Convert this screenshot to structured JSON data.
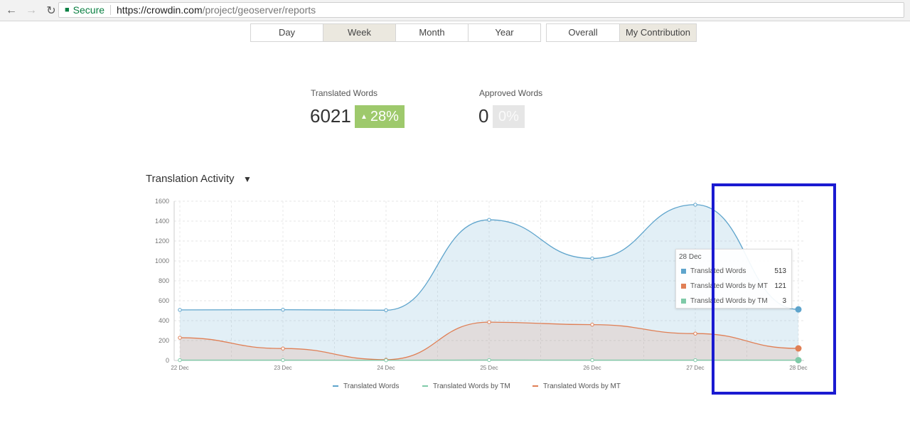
{
  "browser": {
    "secure_label": "Secure",
    "url_host": "https://crowdin.com",
    "url_path": "/project/geoserver/reports"
  },
  "period_tabs": [
    "Day",
    "Week",
    "Month",
    "Year"
  ],
  "period_active": "Week",
  "scope_tabs": [
    "Overall",
    "My Contribution"
  ],
  "scope_active": "My Contribution",
  "stats": {
    "translated_label": "Translated Words",
    "translated_value": "6021",
    "translated_change": "28%",
    "approved_label": "Approved Words",
    "approved_value": "0",
    "approved_change": "0%"
  },
  "section": {
    "title": "Translation Activity"
  },
  "colors": {
    "translated": "#5ea4cc",
    "mt": "#e07f55",
    "tm": "#7fcaa8",
    "badge_green": "#9ec96c",
    "highlight": "#1a1ad1"
  },
  "chart_data": {
    "type": "area",
    "categories": [
      "22 Dec",
      "23 Dec",
      "24 Dec",
      "25 Dec",
      "26 Dec",
      "27 Dec",
      "28 Dec"
    ],
    "series": [
      {
        "name": "Translated Words",
        "values": [
          508,
          510,
          505,
          1413,
          1025,
          1565,
          513
        ]
      },
      {
        "name": "Translated Words by MT",
        "values": [
          228,
          120,
          8,
          385,
          360,
          270,
          121
        ]
      },
      {
        "name": "Translated Words by TM",
        "values": [
          3,
          3,
          2,
          4,
          3,
          3,
          3
        ]
      }
    ],
    "legend_order": [
      "Translated Words",
      "Translated Words by TM",
      "Translated Words by MT"
    ],
    "yticks": [
      0,
      200,
      400,
      600,
      800,
      1000,
      1200,
      1400,
      1600
    ],
    "ylim": [
      0,
      1600
    ],
    "grid": true,
    "legend_position": "bottom",
    "tooltip": {
      "date": "28 Dec",
      "rows": [
        {
          "label": "Translated Words",
          "value": "513"
        },
        {
          "label": "Translated Words by MT",
          "value": "121"
        },
        {
          "label": "Translated Words by TM",
          "value": "3"
        }
      ]
    }
  }
}
